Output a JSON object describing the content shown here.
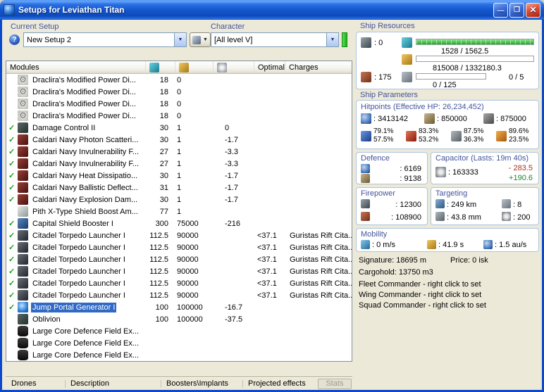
{
  "colors": {
    "selection": "#316AC5",
    "titlebar_blue": "#1557cc",
    "check_green": "#1ca01c",
    "cpu_bar_green": "#28a428",
    "label_blue": "#44549C"
  },
  "window": {
    "title": "Setups for Leviathan Titan",
    "controls": {
      "minimize": "—",
      "maximize": "❐",
      "close": "✕"
    }
  },
  "setup_bar": {
    "current_setup_label": "Current Setup",
    "help_glyph": "?",
    "setup_value": "New Setup 2",
    "character_label": "Character",
    "character_value": "[All level V]"
  },
  "modules_table": {
    "check_glyph": "✓",
    "headers": {
      "modules": "Modules",
      "optimal": "Optimal",
      "charges": "Charges"
    },
    "header_icons": [
      "cpu-icon",
      "powergrid-icon",
      "capacitor-icon"
    ],
    "rows": [
      {
        "icon": "gear",
        "name": "Draclira's Modified Power Di...",
        "cpu": "18",
        "pg": "0"
      },
      {
        "icon": "gear",
        "name": "Draclira's Modified Power Di...",
        "cpu": "18",
        "pg": "0"
      },
      {
        "icon": "gear",
        "name": "Draclira's Modified Power Di...",
        "cpu": "18",
        "pg": "0"
      },
      {
        "icon": "gear",
        "name": "Draclira's Modified Power Di...",
        "cpu": "18",
        "pg": "0"
      },
      {
        "check": true,
        "icon": "dark",
        "name": "Damage Control II",
        "cpu": "30",
        "pg": "1",
        "cap": "0"
      },
      {
        "check": true,
        "icon": "red",
        "name": "Caldari Navy Photon Scatteri...",
        "cpu": "30",
        "pg": "1",
        "cap": "-1.7"
      },
      {
        "check": true,
        "icon": "red",
        "name": "Caldari Navy Invulnerability F...",
        "cpu": "27",
        "pg": "1",
        "cap": "-3.3"
      },
      {
        "check": true,
        "icon": "red",
        "name": "Caldari Navy Invulnerability F...",
        "cpu": "27",
        "pg": "1",
        "cap": "-3.3"
      },
      {
        "check": true,
        "icon": "red",
        "name": "Caldari Navy Heat Dissipatio...",
        "cpu": "30",
        "pg": "1",
        "cap": "-1.7"
      },
      {
        "check": true,
        "icon": "red",
        "name": "Caldari Navy Ballistic Deflect...",
        "cpu": "31",
        "pg": "1",
        "cap": "-1.7"
      },
      {
        "check": true,
        "icon": "red",
        "name": "Caldari Navy Explosion Dam...",
        "cpu": "30",
        "pg": "1",
        "cap": "-1.7"
      },
      {
        "icon": "light",
        "name": "Pith X-Type Shield Boost Am...",
        "cpu": "77",
        "pg": "1"
      },
      {
        "check": true,
        "icon": "blue",
        "name": "Capital Shield Booster I",
        "cpu": "300",
        "pg": "75000",
        "cap": "-216"
      },
      {
        "check": true,
        "icon": "launcher",
        "name": "Citadel Torpedo Launcher I",
        "cpu": "112.5",
        "pg": "90000",
        "optimal": "<37.1",
        "charges": "Guristas Rift Cita..."
      },
      {
        "check": true,
        "icon": "launcher",
        "name": "Citadel Torpedo Launcher I",
        "cpu": "112.5",
        "pg": "90000",
        "optimal": "<37.1",
        "charges": "Guristas Rift Cita..."
      },
      {
        "check": true,
        "icon": "launcher",
        "name": "Citadel Torpedo Launcher I",
        "cpu": "112.5",
        "pg": "90000",
        "optimal": "<37.1",
        "charges": "Guristas Rift Cita..."
      },
      {
        "check": true,
        "icon": "launcher",
        "name": "Citadel Torpedo Launcher I",
        "cpu": "112.5",
        "pg": "90000",
        "optimal": "<37.1",
        "charges": "Guristas Rift Cita..."
      },
      {
        "check": true,
        "icon": "launcher",
        "name": "Citadel Torpedo Launcher I",
        "cpu": "112.5",
        "pg": "90000",
        "optimal": "<37.1",
        "charges": "Guristas Rift Cita..."
      },
      {
        "check": true,
        "icon": "launcher",
        "name": "Citadel Torpedo Launcher I",
        "cpu": "112.5",
        "pg": "90000",
        "optimal": "<37.1",
        "charges": "Guristas Rift Cita..."
      },
      {
        "check": true,
        "icon": "jump",
        "name": "Jump Portal Generator I",
        "cpu": "100",
        "pg": "100000",
        "cap": "-16.7",
        "selected": true
      },
      {
        "icon": "dark",
        "name": "Oblivion",
        "cpu": "100",
        "pg": "100000",
        "cap": "-37.5"
      },
      {
        "icon": "rig",
        "name": "Large Core Defence Field Ex..."
      },
      {
        "icon": "rig",
        "name": "Large Core Defence Field Ex..."
      },
      {
        "icon": "rig",
        "name": "Large Core Defence Field Ex..."
      }
    ]
  },
  "ship_resources": {
    "title": "Ship Resources",
    "turrets": ": 0",
    "launchers": ": 175",
    "cpu": "1528 / 1562.5",
    "powergrid": "815008 / 1332180.3",
    "calibration": "0 / 125",
    "rigs": "0 / 5"
  },
  "ship_parameters": {
    "title": "Ship Parameters",
    "hitpoints": {
      "title": "Hitpoints (Effective HP: 26,234,452)",
      "shield": ": 3413142",
      "armor": ": 850000",
      "structure": ": 875000",
      "resists": [
        {
          "top": "79.1%",
          "bottom": "57.5%"
        },
        {
          "top": "83.3%",
          "bottom": "53.2%"
        },
        {
          "top": "87.5%",
          "bottom": "36.3%"
        },
        {
          "top": "89.6%",
          "bottom": "23.5%"
        }
      ]
    },
    "defence": {
      "title": "Defence",
      "v1": ": 6169",
      "v2": ": 9138"
    },
    "capacitor": {
      "title": "Capacitor (Lasts: 19m 40s)",
      "amount": ": 163333",
      "drain": "- 283.5",
      "recharge": "+190.6"
    },
    "firepower": {
      "title": "Firepower",
      "volley": ": 12300",
      "dps": ": 108900"
    },
    "targeting": {
      "title": "Targeting",
      "range": ": 249 km",
      "max_targets": ": 8",
      "resolution": ": 43.8 mm",
      "scan_strength": ": 200"
    },
    "mobility": {
      "title": "Mobility",
      "speed": ": 0 m/s",
      "align": ": 41.9 s",
      "warp": ": 1.5 au/s"
    }
  },
  "footer_info": {
    "signature": "Signature: 18695 m",
    "price": "Price: 0 isk",
    "cargohold": "Cargohold: 13750 m3",
    "fleet": "Fleet Commander - right click to set",
    "wing": "Wing Commander - right click to set",
    "squad": "Squad Commander - right click to set"
  },
  "bottom_tabs": [
    {
      "label": "Drones"
    },
    {
      "label": "Description"
    },
    {
      "label": "Boosters\\Implants"
    },
    {
      "label": "Projected effects"
    },
    {
      "label": "Stats",
      "disabled": true
    }
  ]
}
